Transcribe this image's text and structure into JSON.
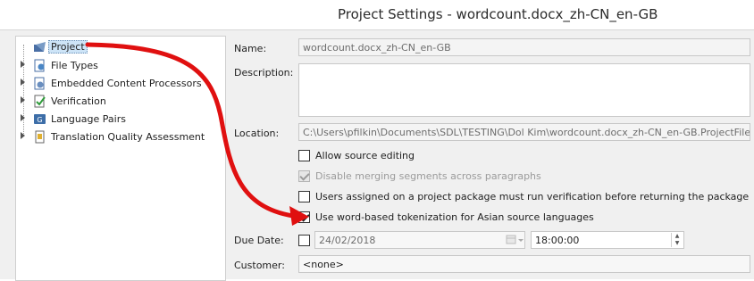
{
  "window": {
    "title": "Project Settings - wordcount.docx_zh-CN_en-GB"
  },
  "tree": {
    "items": [
      {
        "label": "Project",
        "icon": "project-icon",
        "selected": true
      },
      {
        "label": "File Types",
        "icon": "file-types-icon"
      },
      {
        "label": "Embedded Content Processors",
        "icon": "embedded-content-icon"
      },
      {
        "label": "Verification",
        "icon": "verification-icon"
      },
      {
        "label": "Language Pairs",
        "icon": "language-pairs-icon"
      },
      {
        "label": "Translation Quality Assessment",
        "icon": "tqa-icon"
      }
    ]
  },
  "form": {
    "name_label": "Name:",
    "name_value": "wordcount.docx_zh-CN_en-GB",
    "description_label": "Description:",
    "description_value": "",
    "location_label": "Location:",
    "location_value": "C:\\Users\\pfilkin\\Documents\\SDL\\TESTING\\Dol Kim\\wordcount.docx_zh-CN_en-GB.ProjectFiles",
    "checkboxes": [
      {
        "label": "Allow source editing",
        "checked": false,
        "disabled": false
      },
      {
        "label": "Disable merging segments across paragraphs",
        "checked": true,
        "disabled": true
      },
      {
        "label": "Users assigned on a project package must run verification before returning the package",
        "checked": false,
        "disabled": false
      },
      {
        "label": "Use word-based tokenization for Asian source languages",
        "checked": true,
        "disabled": false
      }
    ],
    "due_date_label": "Due Date:",
    "due_date_checked": false,
    "due_date_value": "24/02/2018",
    "due_time_value": "18:00:00",
    "customer_label": "Customer:",
    "customer_value": "<none>"
  },
  "annotation": {
    "arrow_color": "#e01010"
  }
}
